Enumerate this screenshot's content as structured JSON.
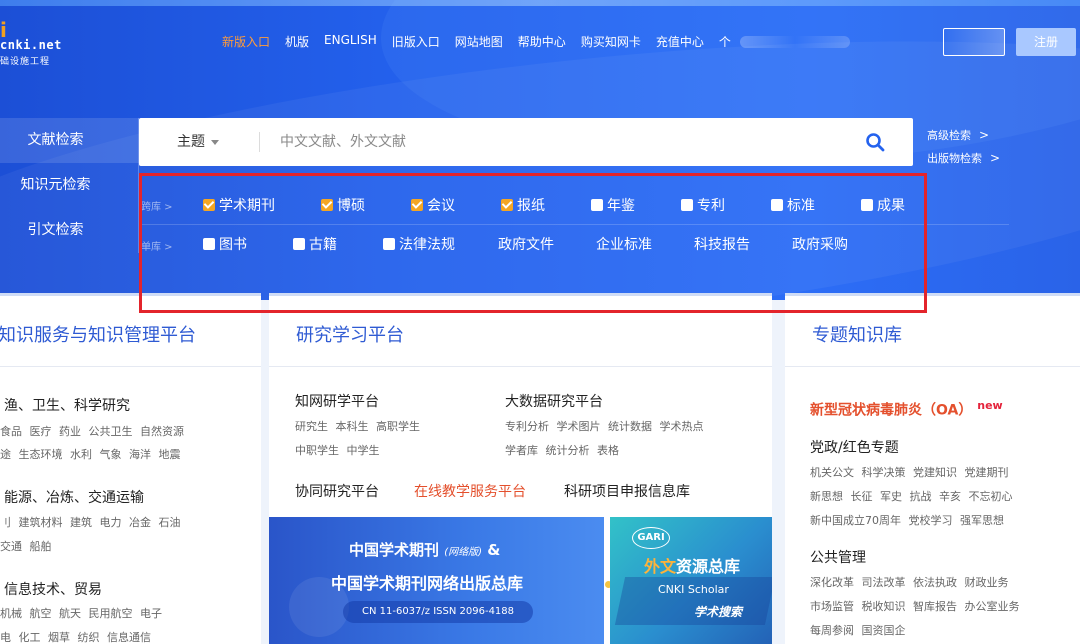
{
  "header": {
    "logo": {
      "mark": "i",
      "site": "cnki.net",
      "slogan": "础设施工程"
    },
    "nav": [
      "新版入口",
      "机版",
      "ENGLISH",
      "旧版入口",
      "网站地图",
      "帮助中心",
      "购买知网卡",
      "充值中心",
      "个"
    ],
    "register": "注册"
  },
  "search": {
    "tabs": [
      "文献检索",
      "知识元检索",
      "引文检索"
    ],
    "field": "主题",
    "placeholder": "中文文献、外文文献",
    "advanced": "高级检索",
    "publication": "出版物检索",
    "arrow": ">"
  },
  "resource_types": {
    "row1_label": "跨库 >",
    "row2_label": "单库 >",
    "row1": [
      {
        "label": "学术期刊",
        "checked": true
      },
      {
        "label": "博硕",
        "checked": true
      },
      {
        "label": "会议",
        "checked": true
      },
      {
        "label": "报纸",
        "checked": true
      },
      {
        "label": "年鉴",
        "checked": false
      },
      {
        "label": "专利",
        "checked": false
      },
      {
        "label": "标准",
        "checked": false
      },
      {
        "label": "成果",
        "checked": false
      }
    ],
    "row2_boxes": [
      {
        "label": "图书",
        "checked": false
      },
      {
        "label": "古籍",
        "checked": false
      },
      {
        "label": "法律法规",
        "checked": false
      }
    ],
    "row2_links": [
      "政府文件",
      "企业标准",
      "科技报告",
      "政府采购"
    ]
  },
  "cards": {
    "knowledge_service": {
      "title": "知识服务与知识管理平台",
      "sections": [
        {
          "heading": "渔、卫生、科学研究",
          "lines": [
            "食品 医疗 药业 公共卫生 自然资源",
            "途 生态环境 水利 气象 海洋 地震"
          ]
        },
        {
          "heading": "能源、冶炼、交通运输",
          "lines": [
            "刂 建筑材料 建筑 电力 冶金 石油",
            "交通 船舶"
          ]
        },
        {
          "heading": "信息技术、贸易",
          "lines": [
            "机械 航空 航天 民用航空 电子",
            "电 化工 烟草 纺织 信息通信"
          ]
        }
      ]
    },
    "research": {
      "title": "研究学习平台",
      "zhiwang": {
        "heading": "知网研学平台",
        "lines": [
          "研究生 本科生 高职学生",
          "中职学生 中学生"
        ]
      },
      "bigdata": {
        "heading": "大数据研究平台",
        "lines": [
          "专利分析 学术图片 统计数据 学术热点",
          "学者库 统计分析 表格"
        ]
      },
      "links": [
        "协同研究平台",
        "在线教学服务平台",
        "科研项目申报信息库"
      ],
      "promo_journal": {
        "line1": "中国学术期刊",
        "line1_small": "(网络版)",
        "line1_tail": "&",
        "line2": "中国学术期刊网络出版总库",
        "issn": "CN 11-6037/z ISSN 2096-4188"
      },
      "promo_gari": {
        "badge": "GARI",
        "t1_o": "外文",
        "t1": "资源总库",
        "t2": "CNKI Scholar",
        "t3": "学术搜索"
      }
    },
    "topics": {
      "title": "专题知识库",
      "covid": "新型冠状病毒肺炎（OA）",
      "new_tag": "new",
      "party_heading": "党政/红色专题",
      "party_lines": [
        "机关公文 科学决策 党建知识 党建期刊",
        "新思想 长征 军史 抗战 辛亥 不忘初心",
        "新中国成立70周年 党校学习 强军思想"
      ],
      "public_heading": "公共管理",
      "public_lines": [
        "深化改革 司法改革 依法执政 财政业务",
        "市场监管 税收知识 智库报告 办公室业务",
        "每周参阅 国资国企"
      ]
    }
  },
  "colors": {
    "accent": "#2462ee",
    "highlight_frame": "#e3242b",
    "orange": "#f5a623",
    "title_blue": "#2f5bd3"
  }
}
